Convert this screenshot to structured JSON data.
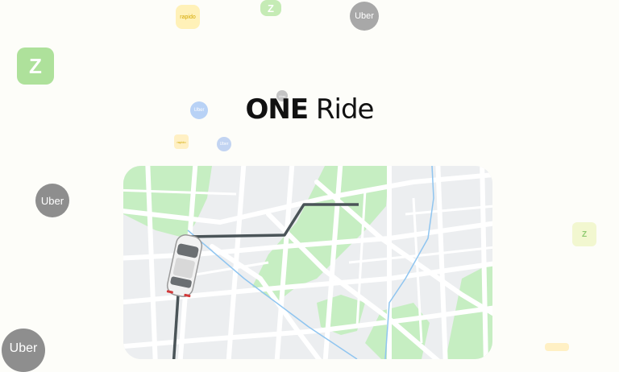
{
  "title": {
    "bold": "ONE",
    "light": "Ride"
  },
  "logos": {
    "uber": "Uber",
    "uber_small": "Uber",
    "rapido": "rapido",
    "zoomcar": "Z"
  },
  "colors": {
    "background": "#fdfdf9",
    "uber_gray": "#8b8b8b",
    "zoom_green": "#b9e6a8",
    "rapido_yellow": "#fff3bf",
    "map_green": "#c6eec2",
    "route": "#4a5458",
    "water_blue": "#8fc5f0"
  },
  "icons": [
    "car-icon",
    "route-line"
  ]
}
